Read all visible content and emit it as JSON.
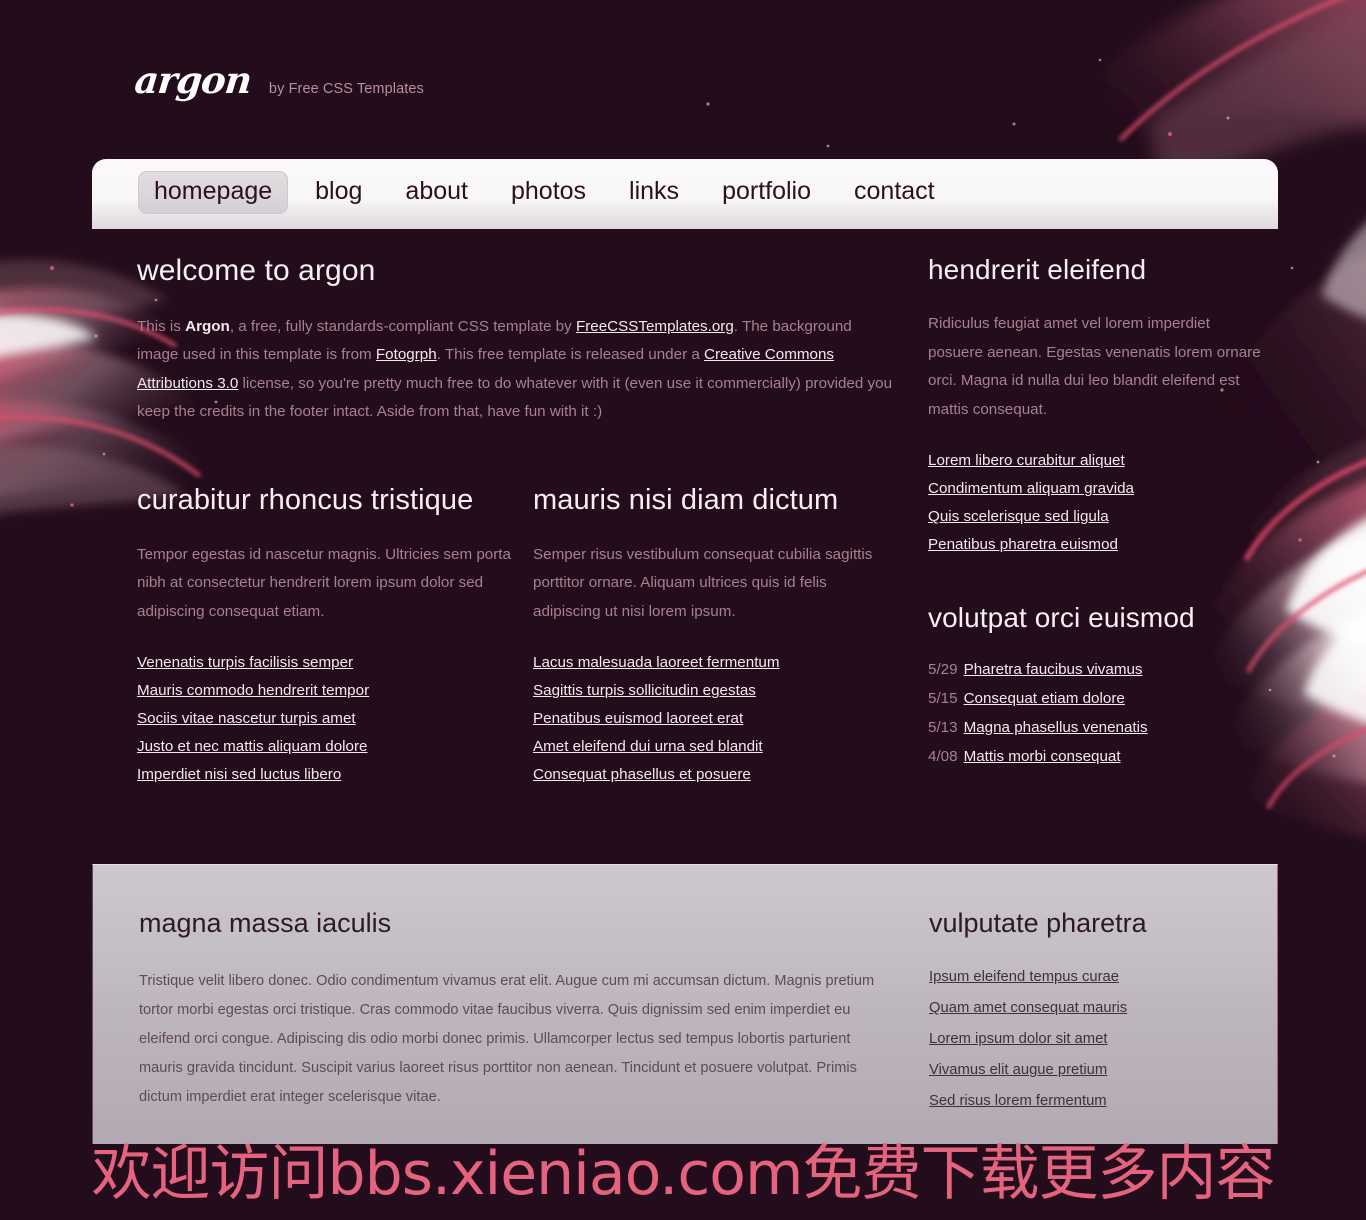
{
  "site": {
    "logo": "argon",
    "tagline": "by Free CSS Templates"
  },
  "nav": {
    "items": [
      {
        "label": "homepage",
        "active": true
      },
      {
        "label": "blog",
        "active": false
      },
      {
        "label": "about",
        "active": false
      },
      {
        "label": "photos",
        "active": false
      },
      {
        "label": "links",
        "active": false
      },
      {
        "label": "portfolio",
        "active": false
      },
      {
        "label": "contact",
        "active": false
      }
    ]
  },
  "welcome": {
    "title": "welcome to argon",
    "p1_a": "This is ",
    "p1_bold": "Argon",
    "p1_b": ", a free, fully standards-compliant CSS template by ",
    "link1": "FreeCSSTemplates.org",
    "p1_c": ". The background image used in this template is from ",
    "link2": "Fotogrph",
    "p1_d": ". This free template is released under a ",
    "link3": "Creative Commons Attributions 3.0",
    "p1_e": " license, so you're pretty much free to do whatever with it (even use it commercially) provided you keep the credits in the footer intact. Aside from that, have fun with it :)"
  },
  "col_left": {
    "title": "curabitur rhoncus tristique",
    "text": "Tempor egestas id nascetur magnis. Ultricies sem porta nibh at consectetur hendrerit lorem ipsum dolor sed adipiscing consequat etiam.",
    "links": [
      "Venenatis turpis facilisis semper",
      "Mauris commodo hendrerit tempor",
      "Sociis vitae nascetur turpis amet",
      "Justo et nec mattis aliquam dolore",
      "Imperdiet nisi sed luctus libero"
    ]
  },
  "col_right": {
    "title": "mauris nisi diam dictum",
    "text": "Semper risus vestibulum consequat cubilia sagittis porttitor ornare. Aliquam ultrices quis id felis adipiscing ut nisi lorem ipsum.",
    "links": [
      "Lacus malesuada laoreet fermentum",
      "Sagittis turpis sollicitudin egestas",
      "Penatibus euismod laoreet erat",
      "Amet eleifend dui urna sed blandit",
      "Consequat phasellus et posuere"
    ]
  },
  "sidebar": {
    "block1": {
      "title": "hendrerit eleifend",
      "text": "Ridiculus feugiat amet vel lorem imperdiet posuere aenean. Egestas venenatis lorem ornare orci. Magna id nulla dui leo blandit eleifend est mattis consequat.",
      "links": [
        "Lorem libero curabitur aliquet",
        "Condimentum aliquam gravida",
        "Quis scelerisque sed ligula",
        "Penatibus pharetra euismod"
      ]
    },
    "block2": {
      "title": "volutpat orci euismod",
      "entries": [
        {
          "date": "5/29",
          "label": "Pharetra faucibus vivamus"
        },
        {
          "date": "5/15",
          "label": "Consequat etiam dolore"
        },
        {
          "date": "5/13",
          "label": "Magna phasellus venenatis"
        },
        {
          "date": "4/08",
          "label": "Mattis morbi consequat"
        }
      ]
    }
  },
  "footer": {
    "left": {
      "title": "magna massa iaculis",
      "text": "Tristique velit libero donec. Odio condimentum vivamus erat elit. Augue cum mi accumsan dictum. Magnis pretium tortor morbi egestas orci tristique. Cras commodo vitae faucibus viverra. Quis dignissim sed enim imperdiet eu eleifend orci congue. Adipiscing dis odio morbi donec primis. Ullamcorper lectus sed tempus lobortis parturient mauris gravida tincidunt. Suscipit varius laoreet risus porttitor non aenean. Tincidunt et posuere volutpat. Primis dictum imperdiet erat integer scelerisque vitae."
    },
    "right": {
      "title": "vulputate pharetra",
      "links": [
        "Ipsum eleifend tempus curae",
        "Quam amet consequat mauris",
        "Lorem ipsum dolor sit amet",
        "Vivamus elit augue pretium",
        "Sed risus lorem fermentum"
      ]
    }
  },
  "watermark": {
    "text": "欢迎访问bbs.xieniao.com免费下载更多内容"
  },
  "colors": {
    "page_bg": "#230c1b",
    "nav_bg": "#faf8f9",
    "heading": "#f7f0f3",
    "body_text": "#a8808f",
    "link": "#f3eaee",
    "footer_bg": "#c5bfc6",
    "footer_text": "#5f4a57",
    "accent_pink": "#e4637f"
  }
}
